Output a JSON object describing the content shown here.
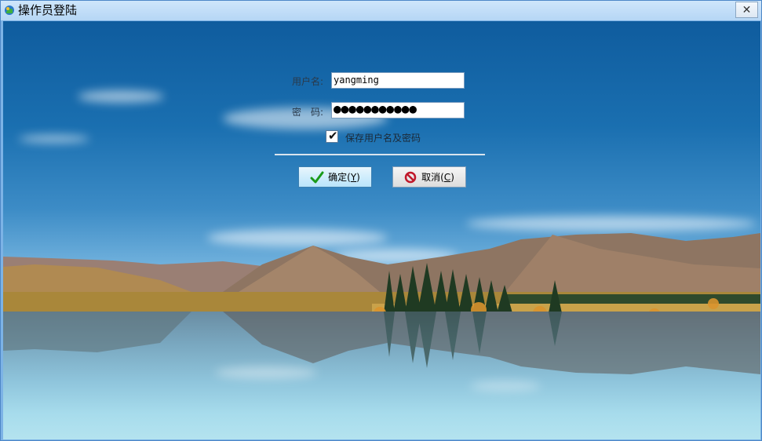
{
  "window": {
    "title": "操作员登陆",
    "close_symbol": "✕"
  },
  "form": {
    "username_label": "用户名:",
    "username_value": "yangming",
    "password_label": "密　码:",
    "password_mask": "●●●●●●●●●●●",
    "remember_label": "保存用户名及密码",
    "remember_checked": true
  },
  "buttons": {
    "ok_label": "确定(",
    "ok_key": "Y",
    "ok_suffix": ")",
    "cancel_label": "取消(",
    "cancel_key": "C",
    "cancel_suffix": ")"
  },
  "icons": {
    "app": "app-icon",
    "ok": "check-icon",
    "cancel": "prohibited-icon",
    "close": "close-icon"
  },
  "colors": {
    "titlebar": "#b6d6f5",
    "ok_check": "#1a9b1a",
    "cancel_icon": "#c0182a"
  }
}
